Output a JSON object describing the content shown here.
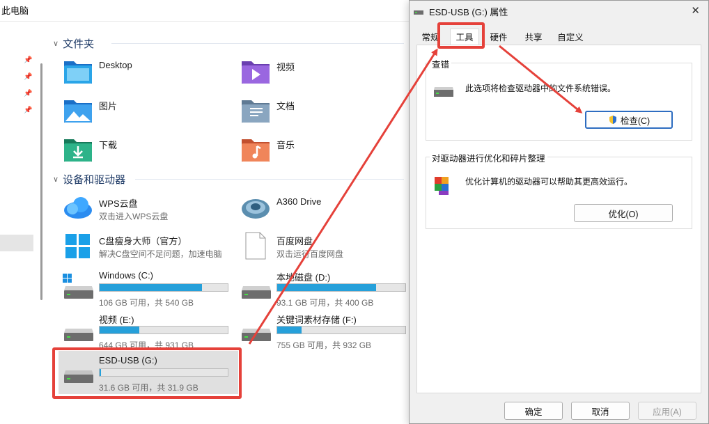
{
  "explorer": {
    "title": "此电脑",
    "sections": {
      "folders": "文件夹",
      "devices": "设备和驱动器"
    },
    "folders": [
      {
        "name": "Desktop"
      },
      {
        "name": "视频"
      },
      {
        "name": "图片"
      },
      {
        "name": "文档"
      },
      {
        "name": "下载"
      },
      {
        "name": "音乐"
      }
    ],
    "apps": [
      {
        "name": "WPS云盘",
        "sub": "双击进入WPS云盘"
      },
      {
        "name": "A360 Drive",
        "sub": ""
      },
      {
        "name": "C盘瘦身大师（官方）",
        "sub": "解决C盘空间不足问题，加速电脑"
      },
      {
        "name": "百度网盘",
        "sub": "双击运行百度网盘"
      }
    ],
    "drives": [
      {
        "name": "Windows (C:)",
        "free": "106 GB 可用，共 540 GB",
        "used_fraction": 0.8
      },
      {
        "name": "本地磁盘 (D:)",
        "free": "93.1 GB 可用，共 400 GB",
        "used_fraction": 0.77
      },
      {
        "name": "视频 (E:)",
        "free": "644 GB 可用，共 931 GB",
        "used_fraction": 0.31
      },
      {
        "name": "关键词素材存储 (F:)",
        "free": "755 GB 可用，共 932 GB",
        "used_fraction": 0.19
      },
      {
        "name": "ESD-USB (G:)",
        "free": "31.6 GB 可用，共 31.9 GB",
        "used_fraction": 0.01
      }
    ]
  },
  "dialog": {
    "title": "ESD-USB (G:) 属性",
    "tabs": [
      "常规",
      "工具",
      "硬件",
      "共享",
      "自定义"
    ],
    "check_group": {
      "title": "查错",
      "desc": "此选项将检查驱动器中的文件系统错误。",
      "button": "检查(C)"
    },
    "optimize_group": {
      "title": "对驱动器进行优化和碎片整理",
      "desc": "优化计算机的驱动器可以帮助其更高效运行。",
      "button": "优化(O)"
    },
    "buttons": {
      "ok": "确定",
      "cancel": "取消",
      "apply": "应用(A)"
    }
  },
  "colors": {
    "accent": "#26a0da",
    "highlight": "#e5413a"
  }
}
